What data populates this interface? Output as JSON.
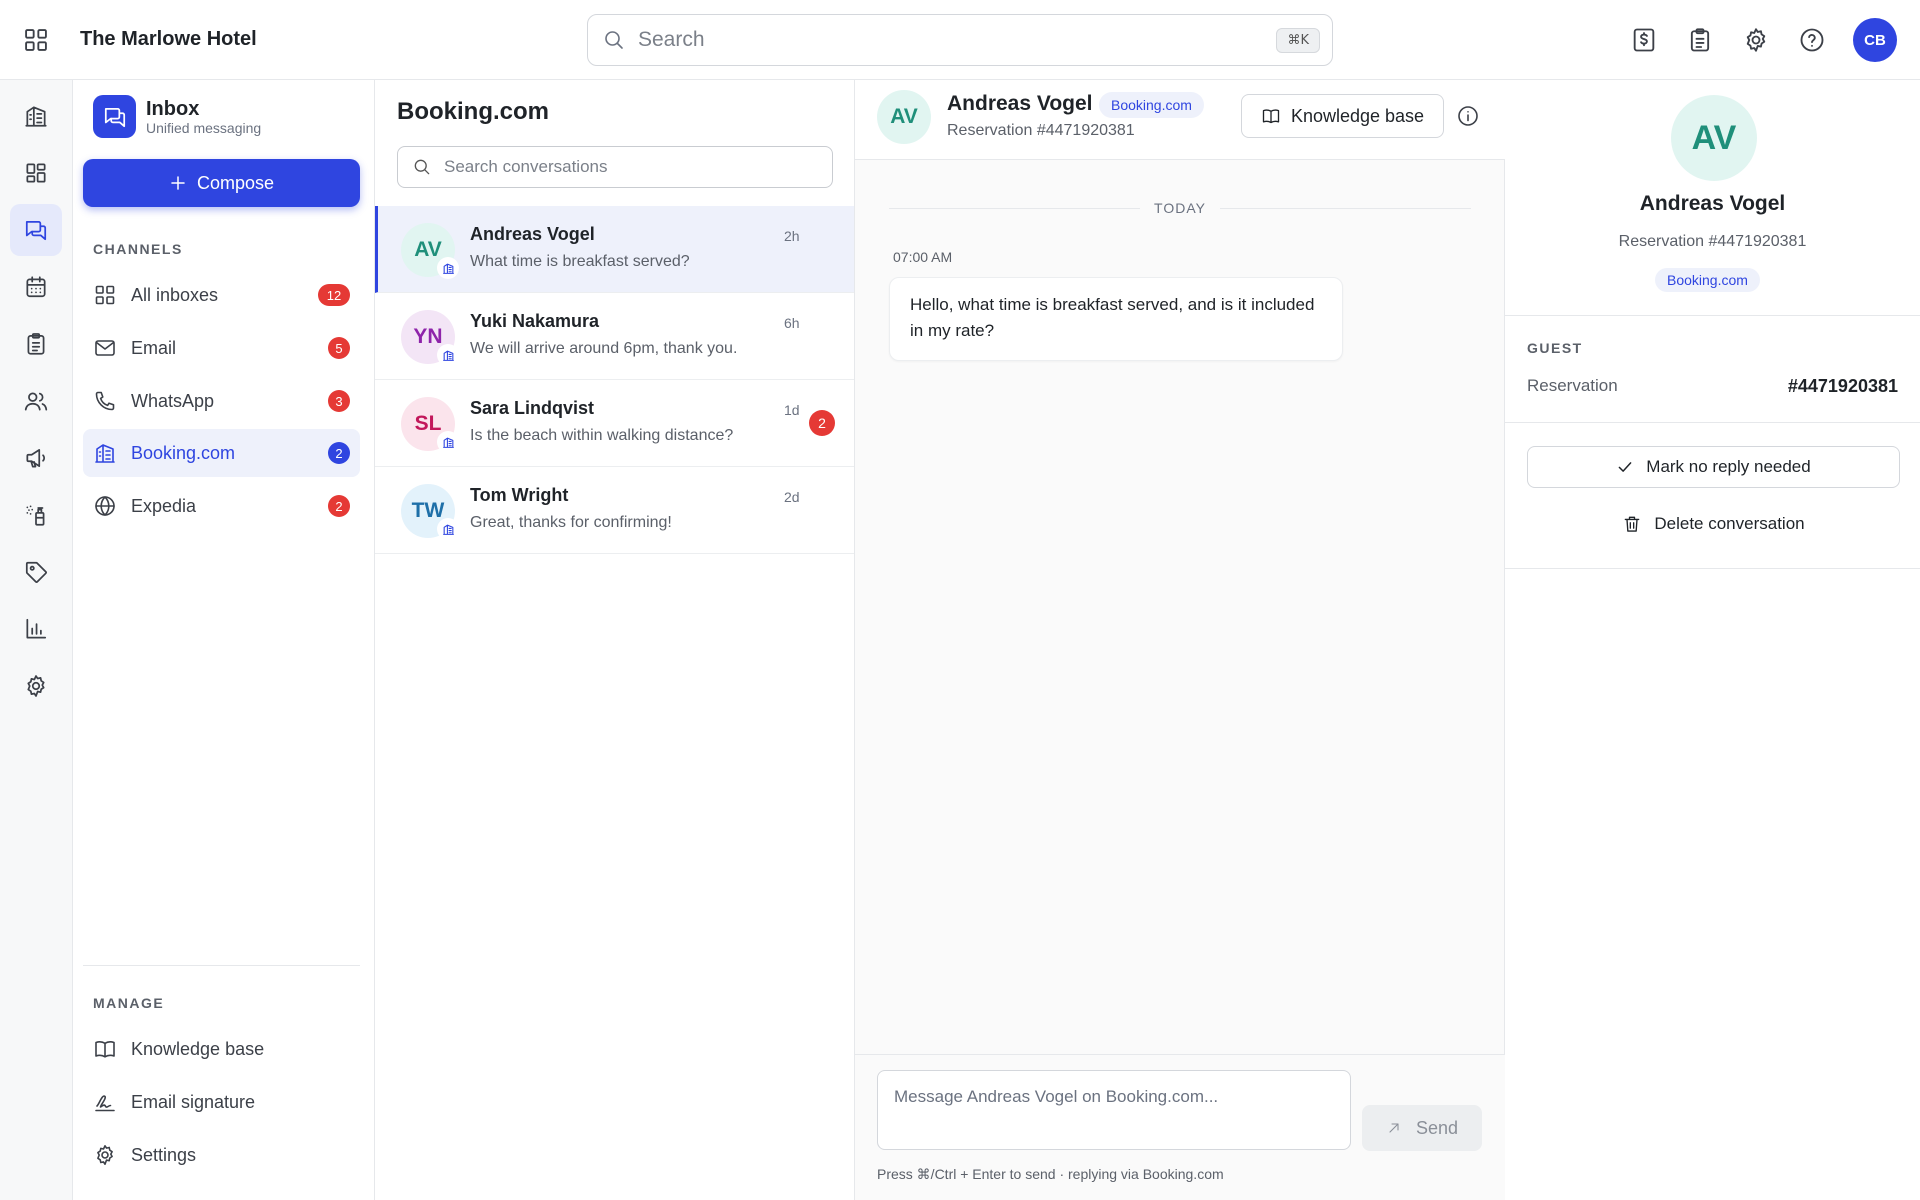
{
  "header": {
    "hotel_name": "The Marlowe Hotel",
    "search_placeholder": "Search",
    "shortcut": "⌘K",
    "avatar_initials": "CB",
    "icons": [
      "billing-icon",
      "clipboard-icon",
      "gear-icon",
      "help-icon"
    ]
  },
  "rail": {
    "items": [
      "building-icon",
      "dashboard-icon",
      "messages-icon",
      "calendar-icon",
      "clipboard-icon",
      "users-icon",
      "megaphone-icon",
      "cleaning-icon",
      "tag-icon",
      "chart-icon",
      "settings-icon"
    ],
    "active": "messages-icon"
  },
  "sidebar": {
    "title": "Inbox",
    "subtitle": "Unified messaging",
    "compose_label": "Compose",
    "channels_label": "CHANNELS",
    "channels": [
      {
        "label": "All inboxes",
        "count": "12"
      },
      {
        "label": "Email",
        "count": "5"
      },
      {
        "label": "WhatsApp",
        "count": "3"
      },
      {
        "label": "Booking.com",
        "count": "2"
      },
      {
        "label": "Expedia",
        "count": "2"
      }
    ],
    "active_channel": "Booking.com",
    "manage_label": "MANAGE",
    "manage": [
      {
        "label": "Knowledge base"
      },
      {
        "label": "Email signature"
      },
      {
        "label": "Settings"
      }
    ]
  },
  "conversations": {
    "title": "Booking.com",
    "search_placeholder": "Search conversations",
    "items": [
      {
        "initials": "AV",
        "name": "Andreas Vogel",
        "preview": "What time is breakfast served?",
        "time": "2h",
        "unread": "",
        "bg": "#e1f5f1",
        "fg": "#1f8f7a"
      },
      {
        "initials": "YN",
        "name": "Yuki Nakamura",
        "preview": "We will arrive around 6pm, thank you.",
        "time": "6h",
        "unread": "",
        "bg": "#f3e5f6",
        "fg": "#8e24aa"
      },
      {
        "initials": "SL",
        "name": "Sara Lindqvist",
        "preview": "Is the beach within walking distance?",
        "time": "1d",
        "unread": "2",
        "bg": "#fbe4ec",
        "fg": "#c2185b"
      },
      {
        "initials": "TW",
        "name": "Tom Wright",
        "preview": "Great, thanks for confirming!",
        "time": "2d",
        "unread": "",
        "bg": "#e3f2fb",
        "fg": "#1e6fa8"
      }
    ]
  },
  "chat": {
    "initials": "AV",
    "name": "Andreas Vogel",
    "channel": "Booking.com",
    "reservation": "Reservation #4471920381",
    "kb_label": "Knowledge base",
    "day_label": "TODAY",
    "message_time": "07:00 AM",
    "message_text": "Hello, what time is breakfast served, and is it included in my rate?",
    "composer_placeholder": "Message Andreas Vogel on Booking.com...",
    "send_label": "Send",
    "hint": "Press ⌘/Ctrl + Enter to send · replying via Booking.com"
  },
  "details": {
    "initials": "AV",
    "name": "Andreas Vogel",
    "reservation": "Reservation #4471920381",
    "channel": "Booking.com",
    "guest_label": "GUEST",
    "reservation_key": "Reservation",
    "reservation_value": "#4471920381",
    "mark_label": "Mark no reply needed",
    "delete_label": "Delete conversation"
  },
  "colors": {
    "accent": "#2f45e0",
    "badge_red": "#e53935"
  }
}
